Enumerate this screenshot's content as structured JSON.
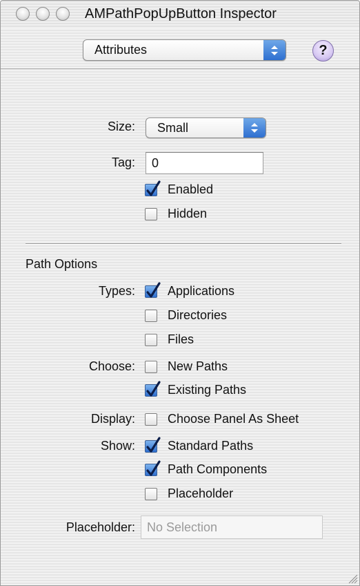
{
  "window": {
    "title": "AMPathPopUpButton Inspector"
  },
  "toolbar": {
    "mode_popup": "Attributes",
    "help_label": "?"
  },
  "attributes": {
    "size_label": "Size:",
    "size_value": "Small",
    "tag_label": "Tag:",
    "tag_value": "0",
    "enabled_label": "Enabled",
    "enabled_checked": true,
    "hidden_label": "Hidden",
    "hidden_checked": false
  },
  "path_options": {
    "section_title": "Path Options",
    "types_label": "Types:",
    "types": [
      {
        "label": "Applications",
        "checked": true
      },
      {
        "label": "Directories",
        "checked": false
      },
      {
        "label": "Files",
        "checked": false
      }
    ],
    "choose_label": "Choose:",
    "choose": [
      {
        "label": "New Paths",
        "checked": false
      },
      {
        "label": "Existing Paths",
        "checked": true
      }
    ],
    "display_label": "Display:",
    "display": [
      {
        "label": "Choose Panel As Sheet",
        "checked": false
      }
    ],
    "show_label": "Show:",
    "show": [
      {
        "label": "Standard Paths",
        "checked": true
      },
      {
        "label": "Path Components",
        "checked": true
      },
      {
        "label": "Placeholder",
        "checked": false
      }
    ],
    "placeholder_label": "Placeholder:",
    "placeholder_value": "No Selection"
  },
  "colors": {
    "accent": "#2f6fcf",
    "help_button": "#d7c9f2"
  }
}
